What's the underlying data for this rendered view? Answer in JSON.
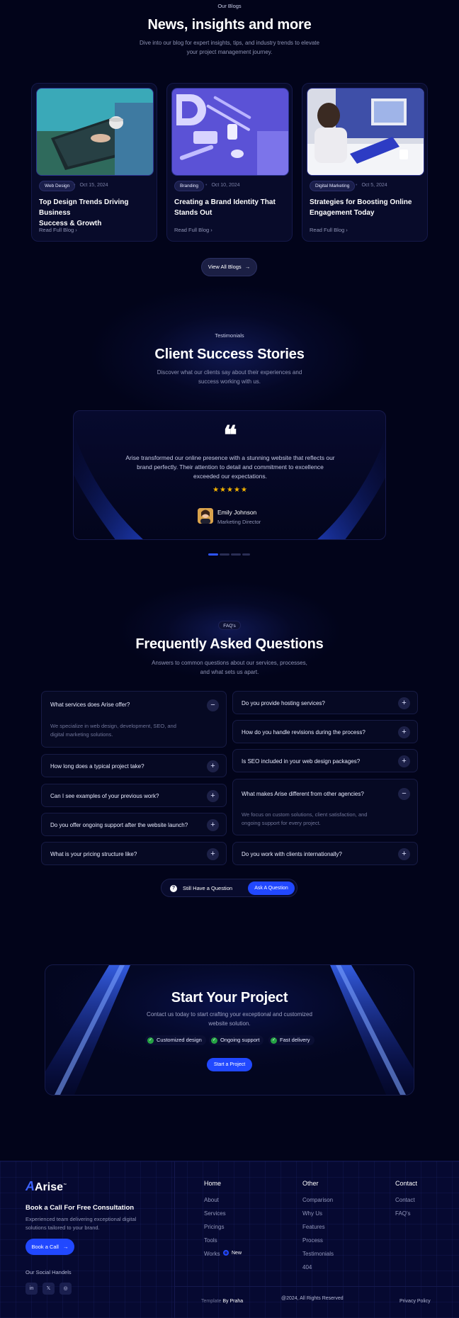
{
  "blogs": {
    "label": "Our Blogs",
    "title": "News, insights and more",
    "subtitle_line1": "Dive into our blog for expert insights, tips, and industry trends to elevate",
    "subtitle_line2": "your project management journey.",
    "posts": [
      {
        "category": "Web Design",
        "date": "Oct 15, 2024",
        "title_line1": "Top Design Trends Driving Business",
        "title_line2": "Success & Growth",
        "link": "Read Full Blog"
      },
      {
        "category": "Branding",
        "date": "Oct 10, 2024",
        "title_line1": "Creating a Brand Identity That",
        "title_line2": "Stands Out",
        "link": "Read Full Blog"
      },
      {
        "category": "Digital Marketing",
        "date": "Oct 5, 2024",
        "title_line1": "Strategies for Boosting Online",
        "title_line2": "Engagement Today",
        "link": "Read Full Blog"
      }
    ],
    "view_all": "View All Blogs"
  },
  "testimonials": {
    "label": "Testimonials",
    "title": "Client Success Stories",
    "subtitle_line1": "Discover what our clients say about their experiences and",
    "subtitle_line2": "success working with us.",
    "quote_line1": "Arise transformed our online presence with a stunning website that reflects our",
    "quote_line2": "brand perfectly. Their attention to detail and commitment to excellence",
    "quote_line3": "exceeded our expectations.",
    "stars": "★★★★★",
    "rating": 5,
    "author": "Emily Johnson",
    "role": "Marketing Director",
    "slides": 4,
    "active_slide": 1
  },
  "faq": {
    "label": "FAQ's",
    "title": "Frequently Asked Questions",
    "subtitle_line1": "Answers to common questions about our services, processes,",
    "subtitle_line2": "and what sets us apart.",
    "left": [
      {
        "q": "What services does Arise offer?",
        "a_line1": "We specialize in web design, development, SEO, and",
        "a_line2": "digital marketing solutions.",
        "open": true
      },
      {
        "q": "How long does a typical project take?",
        "open": false
      },
      {
        "q": "Can I see examples of your previous work?",
        "open": false
      },
      {
        "q": "Do you offer ongoing support after the website launch?",
        "open": false
      },
      {
        "q": "What is your pricing structure like?",
        "open": false
      }
    ],
    "right": [
      {
        "q": "Do you provide hosting services?",
        "open": false
      },
      {
        "q": "How do you handle revisions during the process?",
        "open": false
      },
      {
        "q": "Is SEO included in your web design packages?",
        "open": false
      },
      {
        "q": "What makes Arise different from other agencies?",
        "a_line1": "We focus on custom solutions, client satisfaction, and",
        "a_line2": "ongoing support for every project.",
        "open": true
      },
      {
        "q": "Do you work with clients internationally?",
        "open": false
      }
    ],
    "still_question": "Still Have a Question",
    "ask_button": "Ask A Question"
  },
  "cta": {
    "title": "Start Your Project",
    "subtitle_line1": "Contact us today to start crafting your exceptional and customized",
    "subtitle_line2": "website solution.",
    "features": [
      "Customized design",
      "Ongoing support",
      "Fast delivery"
    ],
    "button": "Start a Project"
  },
  "footer": {
    "logo": "Arise",
    "logo_mark": "A",
    "logo_tm": "™",
    "heading": "Book a Call For Free Consultation",
    "desc_line1": "Experienced team delivering exceptional digital",
    "desc_line2": "solutions tailored to your brand.",
    "book_button": "Book a Call",
    "social_label": "Our Social Handels",
    "home_title": "Home",
    "home_links": [
      "About",
      "Services",
      "Pricings",
      "Tools",
      "Works"
    ],
    "new_badge": "New",
    "other_title": "Other",
    "other_links": [
      "Comparison",
      "Why Us",
      "Features",
      "Process",
      "Testimonials",
      "404"
    ],
    "contact_title": "Contact",
    "contact_links": [
      "Contact",
      "FAQ's"
    ],
    "template_prefix": "Template",
    "template_by": "By Praha",
    "copyright": "@2024, All Rights Reserved",
    "privacy": "Privacy Policy"
  },
  "colors": {
    "background": "#02041a",
    "accent": "#2148ff",
    "star": "#f5b400",
    "check": "#25a244"
  }
}
